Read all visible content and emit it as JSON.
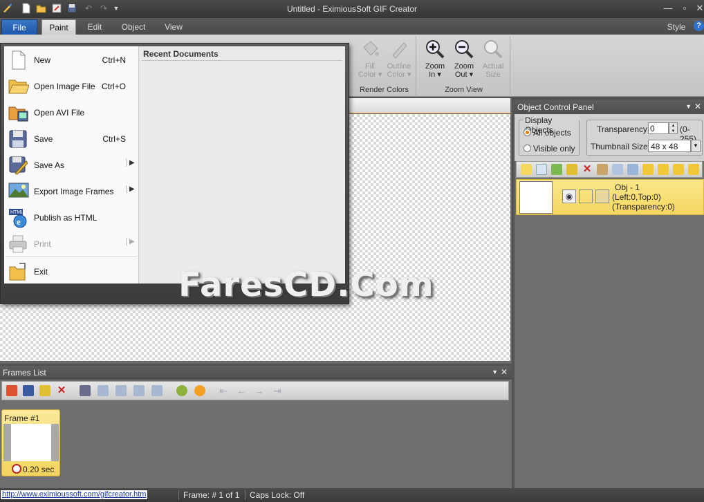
{
  "window": {
    "title": "Untitled - EximiousSoft GIF Creator",
    "style_label": "Style",
    "help_glyph": "?"
  },
  "tabs": {
    "file": "File",
    "paint": "Paint",
    "edit": "Edit",
    "object": "Object",
    "view": "View"
  },
  "ribbon": {
    "render_colors": {
      "label": "Render Colors",
      "fill_line1": "Fill",
      "fill_line2": "Color",
      "outline_line1": "Outline",
      "outline_line2": "Color"
    },
    "zoom_view": {
      "label": "Zoom View",
      "zoom_in_line1": "Zoom",
      "zoom_in_line2": "In",
      "zoom_out_line1": "Zoom",
      "zoom_out_line2": "Out",
      "actual_line1": "Actual",
      "actual_line2": "Size"
    }
  },
  "file_menu": {
    "recent_documents_label": "Recent Documents",
    "items": [
      {
        "label": "New",
        "shortcut": "Ctrl+N"
      },
      {
        "label": "Open Image File",
        "shortcut": "Ctrl+O"
      },
      {
        "label": "Open AVI File",
        "shortcut": ""
      },
      {
        "label": "Save",
        "shortcut": "Ctrl+S"
      },
      {
        "label": "Save As",
        "shortcut": ""
      },
      {
        "label": "Export Image Frames",
        "shortcut": ""
      },
      {
        "label": "Publish as HTML",
        "shortcut": ""
      },
      {
        "label": "Print",
        "shortcut": ""
      },
      {
        "label": "Exit",
        "shortcut": ""
      }
    ]
  },
  "watermark": "FaresCD.Com",
  "object_panel": {
    "title": "Object Control Panel",
    "display_objects_label": "Display Objects",
    "all_objects": "All objects",
    "visible_only": "Visible only",
    "transparency_label": "Transparency:",
    "transparency_value": "0",
    "transparency_range": "(0-255)",
    "thumbnail_label": "Thumbnail Size:",
    "thumbnail_value": "48 x 48",
    "object": {
      "name": "Obj - 1",
      "position": "(Left:0,Top:0)",
      "transparency": "(Transparency:0)"
    }
  },
  "frames_list": {
    "title": "Frames List",
    "frame": {
      "name": "Frame #1",
      "duration": "0.20 sec"
    }
  },
  "status": {
    "url": "http://www.eximioussoft.com/gifcreator.htm",
    "frame": "Frame: # 1 of 1",
    "caps": "Caps Lock: Off"
  },
  "colors": {
    "accent_blue": "#2a63b5",
    "highlight_yellow": "#f7dc6f",
    "orange": "#e07b00"
  }
}
